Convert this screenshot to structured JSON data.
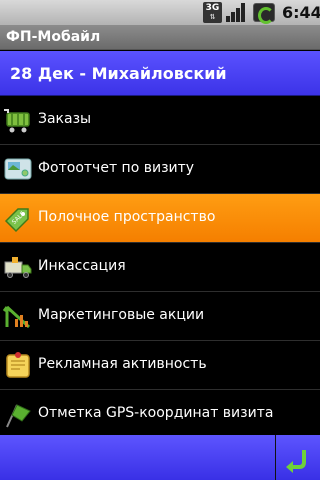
{
  "status_bar": {
    "network": "3G",
    "time": "6:44"
  },
  "app": {
    "title": "ФП-Мобайл"
  },
  "header": {
    "title": "28 Дек - Михайловский"
  },
  "menu": {
    "items": [
      {
        "label": "Заказы",
        "icon": "cart-icon"
      },
      {
        "label": "Фотоотчет по визиту",
        "icon": "photo-icon"
      },
      {
        "label": "Полочное пространство",
        "icon": "price-tag-icon",
        "selected": true
      },
      {
        "label": "Инкассация",
        "icon": "truck-icon"
      },
      {
        "label": "Маркетинговые акции",
        "icon": "growth-arrow-icon"
      },
      {
        "label": "Рекламная активность",
        "icon": "note-icon"
      },
      {
        "label": "Отметка GPS-координат визита",
        "icon": "flag-icon"
      }
    ]
  },
  "colors": {
    "header": "#4a42f5",
    "selected": "#f88a00",
    "status_bar": "#c8c8c8"
  }
}
